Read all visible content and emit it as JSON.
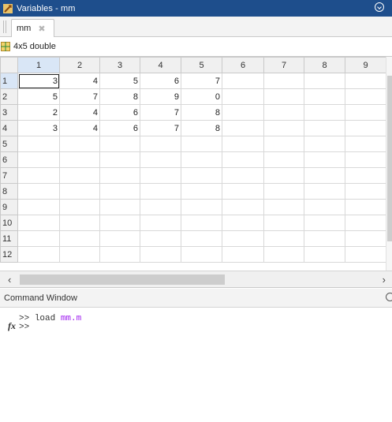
{
  "window": {
    "title": "Variables - mm",
    "icon": "variables-editor-icon"
  },
  "tabs": [
    {
      "label": "mm",
      "close": "✖"
    }
  ],
  "variable": {
    "size_label": "4x5 double",
    "icon": "grid-icon"
  },
  "sheet": {
    "column_headers": [
      "1",
      "2",
      "3",
      "4",
      "5",
      "6",
      "7",
      "8",
      "9"
    ],
    "row_headers": [
      "1",
      "2",
      "3",
      "4",
      "5",
      "6",
      "7",
      "8",
      "9",
      "10",
      "11",
      "12"
    ],
    "rows": [
      [
        "3",
        "4",
        "5",
        "6",
        "7",
        "",
        "",
        "",
        ""
      ],
      [
        "5",
        "7",
        "8",
        "9",
        "0",
        "",
        "",
        "",
        ""
      ],
      [
        "2",
        "4",
        "6",
        "7",
        "8",
        "",
        "",
        "",
        ""
      ],
      [
        "3",
        "4",
        "6",
        "7",
        "8",
        "",
        "",
        "",
        ""
      ],
      [
        "",
        "",
        "",
        "",
        "",
        "",
        "",
        "",
        ""
      ],
      [
        "",
        "",
        "",
        "",
        "",
        "",
        "",
        "",
        ""
      ],
      [
        "",
        "",
        "",
        "",
        "",
        "",
        "",
        "",
        ""
      ],
      [
        "",
        "",
        "",
        "",
        "",
        "",
        "",
        "",
        ""
      ],
      [
        "",
        "",
        "",
        "",
        "",
        "",
        "",
        "",
        ""
      ],
      [
        "",
        "",
        "",
        "",
        "",
        "",
        "",
        "",
        ""
      ],
      [
        "",
        "",
        "",
        "",
        "",
        "",
        "",
        "",
        ""
      ],
      [
        "",
        "",
        "",
        "",
        "",
        "",
        "",
        "",
        ""
      ]
    ],
    "active_cell": {
      "row": 1,
      "col": 1
    }
  },
  "scrollbars": {
    "left_arrow": "‹",
    "right_arrow": "›"
  },
  "command_window": {
    "title": "Command Window",
    "prompt": ">>",
    "history_command": "load",
    "history_argument": "mm.m",
    "fx_label": "fx"
  },
  "colors": {
    "titlebar": "#1e4e8c",
    "command_argument": "#a020f0"
  }
}
